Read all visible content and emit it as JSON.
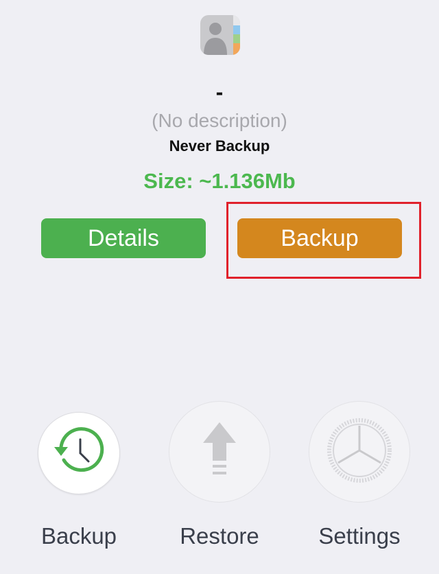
{
  "app": {
    "icon": "contacts-icon",
    "title": "-",
    "description": "(No description)",
    "backup_status": "Never Backup",
    "size": "Size: ~1.136Mb"
  },
  "actions": {
    "details_label": "Details",
    "backup_label": "Backup"
  },
  "tabbar": {
    "items": [
      {
        "label": "Backup",
        "icon": "clock-backup-icon",
        "active": true
      },
      {
        "label": "Restore",
        "icon": "upload-arrow-icon",
        "active": false
      },
      {
        "label": "Settings",
        "icon": "gear-icon",
        "active": false
      }
    ]
  },
  "colors": {
    "accent_green": "#4cb04f",
    "accent_orange": "#d4871e",
    "highlight_red": "#e0212b",
    "background": "#efeff4"
  }
}
